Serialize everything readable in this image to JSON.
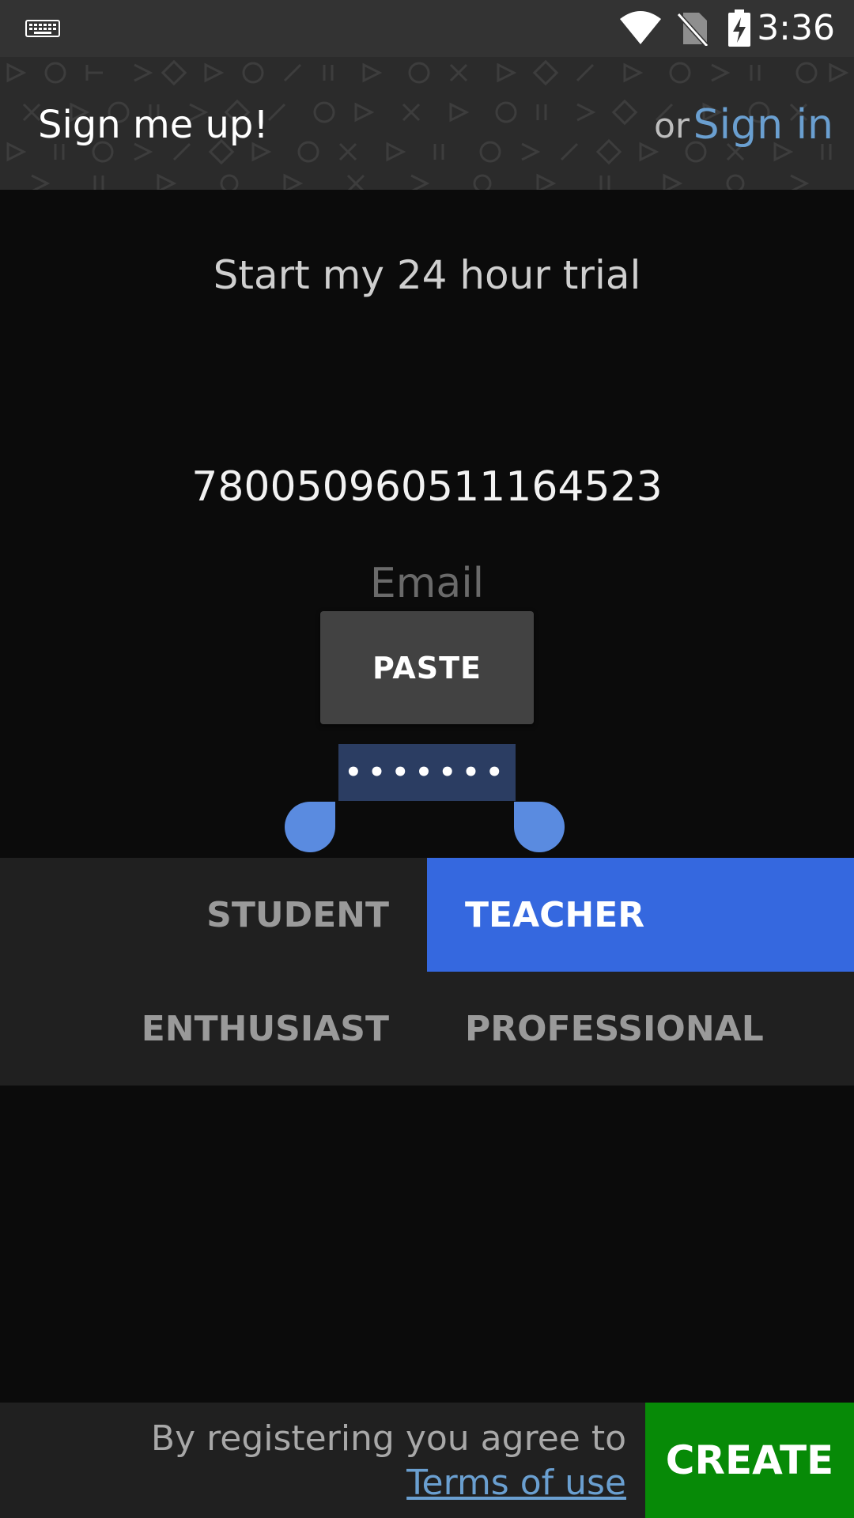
{
  "status_bar": {
    "time": "3:36",
    "icons": [
      "keyboard-icon",
      "wifi-icon",
      "no-sim-icon",
      "battery-charging-icon"
    ]
  },
  "header": {
    "title": "Sign me up!",
    "or_text": "or",
    "sign_in_label": "Sign in"
  },
  "main": {
    "trial_text": "Start my 24 hour trial",
    "user_code": "780050960511164523",
    "email_placeholder": "Email",
    "paste_label": "PASTE",
    "password_value": "•••••••"
  },
  "roles": [
    {
      "label": "STUDENT",
      "selected": false
    },
    {
      "label": "TEACHER",
      "selected": true
    },
    {
      "label": "ENTHUSIAST",
      "selected": false
    },
    {
      "label": "PROFESSIONAL",
      "selected": false
    }
  ],
  "footer": {
    "agree_text": "By registering you agree to",
    "terms_label": "Terms of use",
    "create_label": "CREATE"
  },
  "colors": {
    "accent_blue": "#3568df",
    "link_blue": "#6a9fd0",
    "create_green": "#078a07",
    "background": "#0b0b0b"
  }
}
